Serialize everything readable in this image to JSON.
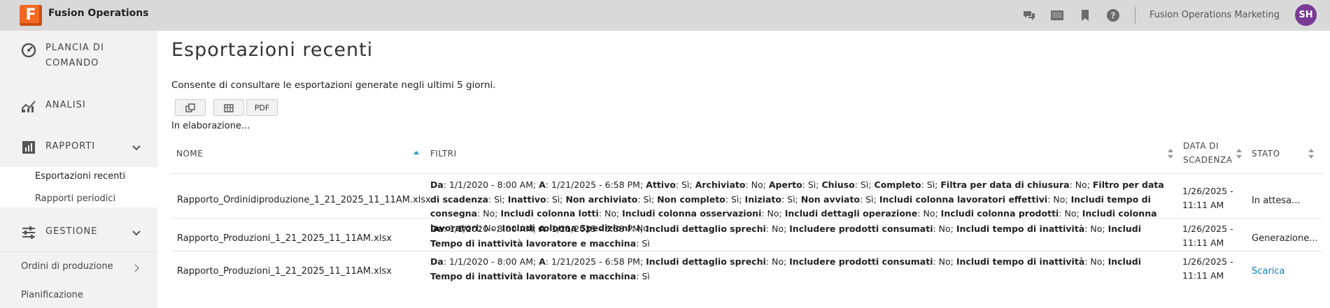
{
  "app": {
    "logo_letter": "F",
    "title": "Fusion Operations",
    "tenant": "Fusion Operations Marketing",
    "avatar_initials": "SH"
  },
  "top_icons": [
    "chat-icon",
    "screen-icon",
    "bookmark-icon",
    "help-icon"
  ],
  "sidebar": {
    "items": [
      {
        "label": "PLANCIA DI COMANDO",
        "icon": "dashboard-icon"
      },
      {
        "label": "ANALISI",
        "icon": "analytics-icon"
      },
      {
        "label": "RAPPORTI",
        "icon": "reports-icon"
      },
      {
        "label": "GESTIONE",
        "icon": "sliders-icon"
      }
    ],
    "report_sub": [
      "Esportazioni recenti",
      "Rapporti periodici"
    ],
    "plain": [
      "Ordini di produzione",
      "Pianificazione"
    ]
  },
  "main": {
    "title": "Esportazioni recenti",
    "description": "Consente di consultare le esportazioni generate negli ultimi 5 giorni.",
    "buttons": {
      "pdf": "PDF"
    },
    "processing": "In elaborazione..."
  },
  "table": {
    "headers": {
      "name": "NOME",
      "filters": "FILTRI",
      "due_date": "DATA DI SCADENZA",
      "status": "STATO"
    },
    "rows": [
      {
        "name": "Rapporto_Ordinidiproduzione_1_21_2025_11_11AM.xlsx",
        "filters": [
          [
            "Da",
            "1/1/2020 - 8:00 AM"
          ],
          [
            "A",
            "1/21/2025 - 6:58 PM"
          ],
          [
            "Attivo",
            "Sì"
          ],
          [
            "Archiviato",
            "No"
          ],
          [
            "Aperto",
            "Sì"
          ],
          [
            "Chiuso",
            "Sì"
          ],
          [
            "Completo",
            "Sì"
          ],
          [
            "Filtra per data di chiusura",
            "No"
          ],
          [
            "Filtro per data di scadenza",
            "Sì"
          ],
          [
            "Inattivo",
            "Sì"
          ],
          [
            "Non archiviato",
            "Sì"
          ],
          [
            "Non completo",
            "Sì"
          ],
          [
            "Iniziato",
            "Sì"
          ],
          [
            "Non avviato",
            "Sì"
          ],
          [
            "Includi colonna lavoratori effettivi",
            "No"
          ],
          [
            "Includi tempo di consegna",
            "No"
          ],
          [
            "Includi colonna lotti",
            "No"
          ],
          [
            "Includi colonna osservazioni",
            "No"
          ],
          [
            "Includi dettagli operazione",
            "No"
          ],
          [
            "Includi colonna prodotti",
            "No"
          ],
          [
            "Includi colonna lavoratori",
            "No"
          ],
          [
            "Includi colonna Spedizioni",
            "No"
          ]
        ],
        "due_date": "1/26/2025 - 11:11 AM",
        "status": "In attesa..."
      },
      {
        "name": "Rapporto_Produzioni_1_21_2025_11_11AM.xlsx",
        "filters": [
          [
            "Da",
            "1/1/2020 - 8:00 AM"
          ],
          [
            "A",
            "1/21/2025 - 6:58 PM"
          ],
          [
            "Includi dettaglio sprechi",
            "No"
          ],
          [
            "Includere prodotti consumati",
            "No"
          ],
          [
            "Includi tempo di inattività",
            "No"
          ],
          [
            "Includi Tempo di inattività lavoratore e macchina",
            "Sì"
          ]
        ],
        "due_date": "1/26/2025 - 11:11 AM",
        "status": "Generazione..."
      },
      {
        "name": "Rapporto_Produzioni_1_21_2025_11_11AM.xlsx",
        "filters": [
          [
            "Da",
            "1/1/2020 - 8:00 AM"
          ],
          [
            "A",
            "1/21/2025 - 6:58 PM"
          ],
          [
            "Includi dettaglio sprechi",
            "No"
          ],
          [
            "Includere prodotti consumati",
            "No"
          ],
          [
            "Includi tempo di inattività",
            "No"
          ],
          [
            "Includi Tempo di inattività lavoratore e macchina",
            "Sì"
          ]
        ],
        "due_date": "1/26/2025 - 11:11 AM",
        "status": "Scarica"
      }
    ]
  },
  "colors": {
    "accent_orange": "#f26a21",
    "link_blue": "#0a7bb8",
    "avatar_purple": "#7a3a96",
    "sort_active": "#1a9bc6"
  }
}
